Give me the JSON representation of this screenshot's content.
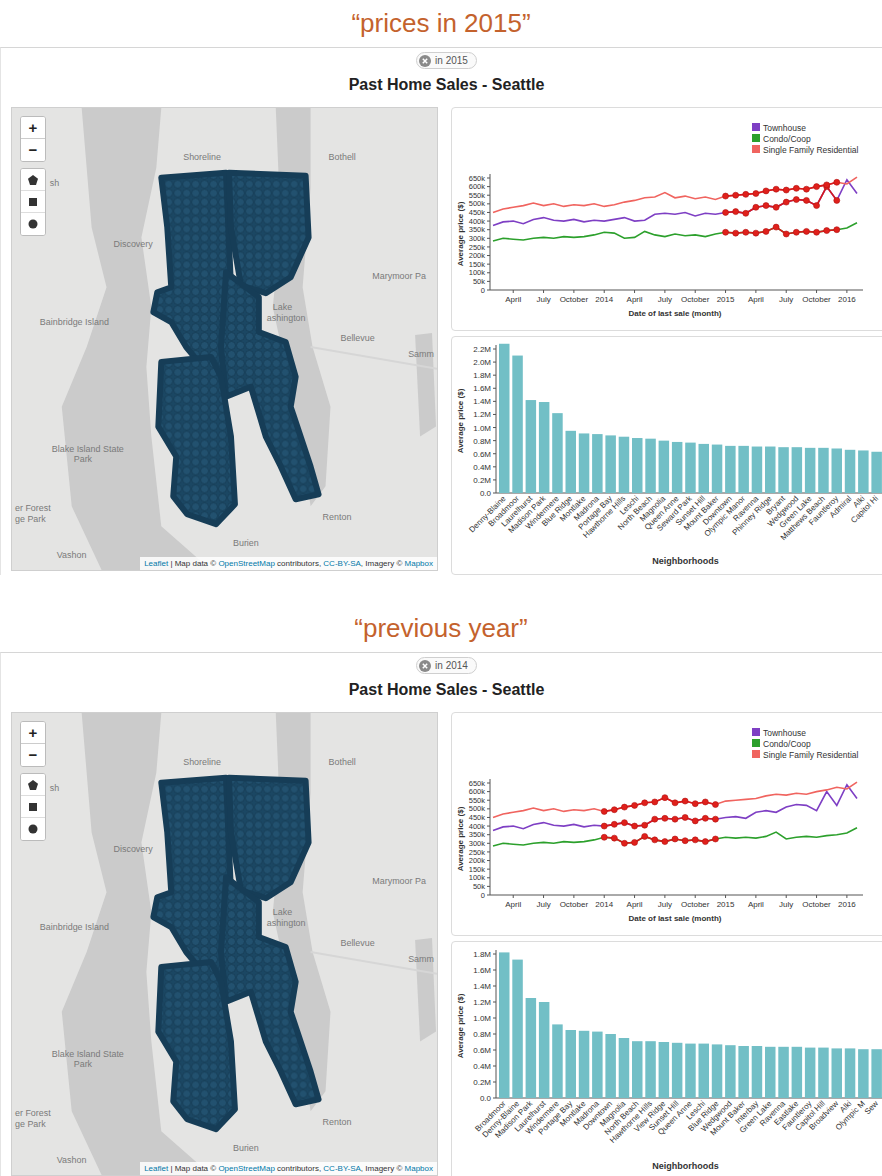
{
  "map": {
    "zoom_buttons": [
      "+",
      "−"
    ],
    "labels": [
      "Shoreline",
      "Bothell",
      "sh",
      "Discovery",
      "Marymoor Pa",
      "Bainbridge Island",
      "Lake",
      "ashington",
      "Bellevue",
      "Samm",
      "Blake Island State",
      "Park",
      "er Forest",
      "ge Park",
      "Renton",
      "Burien",
      "Vashon"
    ],
    "attribution": [
      {
        "text": "Leaflet",
        "link": true
      },
      {
        "text": " | Map data © ",
        "link": false
      },
      {
        "text": "OpenStreetMap",
        "link": true
      },
      {
        "text": " contributors, ",
        "link": false
      },
      {
        "text": "CC-BY-SA",
        "link": true
      },
      {
        "text": ", Imagery © ",
        "link": false
      },
      {
        "text": "Mapbox",
        "link": true
      }
    ]
  },
  "line_chart": {
    "y_label": "Average price ($)",
    "x_label": "Date of last sale (month)",
    "series": [
      {
        "name": "Townhouse",
        "color": "#7e3fc4",
        "values": [
          375000,
          395000,
          400000,
          385000,
          410000,
          420000,
          405000,
          400000,
          410000,
          395000,
          405000,
          400000,
          410000,
          420000,
          400000,
          405000,
          440000,
          445000,
          440000,
          450000,
          430000,
          445000,
          440000,
          450000,
          455000,
          445000,
          480000,
          490000,
          480000,
          510000,
          525000,
          520000,
          490000,
          600000,
          520000,
          640000,
          560000
        ]
      },
      {
        "name": "Condo/Coop",
        "color": "#2ca02c",
        "values": [
          285000,
          300000,
          295000,
          290000,
          300000,
          305000,
          300000,
          310000,
          305000,
          310000,
          320000,
          335000,
          330000,
          300000,
          305000,
          340000,
          320000,
          310000,
          325000,
          315000,
          320000,
          310000,
          325000,
          335000,
          330000,
          335000,
          330000,
          340000,
          365000,
          325000,
          335000,
          340000,
          335000,
          345000,
          350000,
          360000,
          390000
        ]
      },
      {
        "name": "Single Family Residential",
        "color": "#f0645f",
        "values": [
          450000,
          470000,
          480000,
          490000,
          505000,
          490000,
          500000,
          485000,
          495000,
          490000,
          500000,
          485000,
          495000,
          510000,
          520000,
          535000,
          540000,
          565000,
          535000,
          545000,
          530000,
          540000,
          525000,
          545000,
          550000,
          555000,
          560000,
          575000,
          585000,
          580000,
          590000,
          585000,
          600000,
          610000,
          625000,
          615000,
          655000
        ]
      }
    ],
    "y_ticks": [
      {
        "label": "650k",
        "value": 650000
      },
      {
        "label": "600k",
        "value": 600000
      },
      {
        "label": "550k",
        "value": 550000
      },
      {
        "label": "500k",
        "value": 500000
      },
      {
        "label": "450k",
        "value": 450000
      },
      {
        "label": "400k",
        "value": 400000
      },
      {
        "label": "350k",
        "value": 350000
      },
      {
        "label": "300k",
        "value": 300000
      },
      {
        "label": "250k",
        "value": 250000
      },
      {
        "label": "200k",
        "value": 200000
      },
      {
        "label": "150k",
        "value": 150000
      },
      {
        "label": "100k",
        "value": 100000
      },
      {
        "label": "50k",
        "value": 50000
      },
      {
        "label": "0",
        "value": 0
      }
    ],
    "x_ticks": [
      {
        "label": "April",
        "month": 2
      },
      {
        "label": "July",
        "month": 5
      },
      {
        "label": "October",
        "month": 8
      },
      {
        "label": "2014",
        "month": 11
      },
      {
        "label": "April",
        "month": 14
      },
      {
        "label": "July",
        "month": 17
      },
      {
        "label": "October",
        "month": 20
      },
      {
        "label": "2015",
        "month": 23
      },
      {
        "label": "April",
        "month": 26
      },
      {
        "label": "July",
        "month": 29
      },
      {
        "label": "October",
        "month": 32
      },
      {
        "label": "2016",
        "month": 35
      }
    ]
  },
  "panels": [
    {
      "caption": "“prices in 2015”",
      "filter_chip": "in 2015",
      "title": "Past Home Sales - Seattle",
      "highlight": {
        "from": 23,
        "to": 34
      },
      "bar_chart": {
        "y_label": "Average price ($)",
        "x_label": "Neighborhoods",
        "y_ticks": [
          {
            "label": "2.2M",
            "value": 2200000
          },
          {
            "label": "2.0M",
            "value": 2000000
          },
          {
            "label": "1.8M",
            "value": 1800000
          },
          {
            "label": "1.6M",
            "value": 1600000
          },
          {
            "label": "1.4M",
            "value": 1400000
          },
          {
            "label": "1.2M",
            "value": 1200000
          },
          {
            "label": "1.0M",
            "value": 1000000
          },
          {
            "label": "0.8M",
            "value": 800000
          },
          {
            "label": "0.6M",
            "value": 600000
          },
          {
            "label": "0.4M",
            "value": 400000
          },
          {
            "label": "0.2M",
            "value": 200000
          },
          {
            "label": "0.0",
            "value": 0
          }
        ],
        "bars": [
          {
            "label": "Denny-Blaine",
            "value": 2280000
          },
          {
            "label": "Broadmoor",
            "value": 2100000
          },
          {
            "label": "Laurelhurst",
            "value": 1420000
          },
          {
            "label": "Madison Park",
            "value": 1390000
          },
          {
            "label": "Windermere",
            "value": 1220000
          },
          {
            "label": "Blue Ridge",
            "value": 950000
          },
          {
            "label": "Montlake",
            "value": 910000
          },
          {
            "label": "Madrona",
            "value": 900000
          },
          {
            "label": "Portage Bay",
            "value": 880000
          },
          {
            "label": "Hawthorne Hills",
            "value": 860000
          },
          {
            "label": "Leschi",
            "value": 840000
          },
          {
            "label": "North Beach",
            "value": 830000
          },
          {
            "label": "Magnolia",
            "value": 800000
          },
          {
            "label": "Queen Anne",
            "value": 780000
          },
          {
            "label": "Seward Park",
            "value": 770000
          },
          {
            "label": "Sunset Hill",
            "value": 750000
          },
          {
            "label": "Mount Baker",
            "value": 740000
          },
          {
            "label": "Downtown",
            "value": 720000
          },
          {
            "label": "Olympic Manor",
            "value": 720000
          },
          {
            "label": "Ravenna",
            "value": 710000
          },
          {
            "label": "Phinney Ridge",
            "value": 710000
          },
          {
            "label": "Bryant",
            "value": 700000
          },
          {
            "label": "Wedgwood",
            "value": 700000
          },
          {
            "label": "Green Lake",
            "value": 690000
          },
          {
            "label": "Matthews Beach",
            "value": 690000
          },
          {
            "label": "Fauntleroy",
            "value": 680000
          },
          {
            "label": "Admiral",
            "value": 660000
          },
          {
            "label": "Alki",
            "value": 650000
          },
          {
            "label": "Capitol Hi",
            "value": 630000
          }
        ]
      }
    },
    {
      "caption": "“previous year”",
      "filter_chip": "in 2014",
      "title": "Past Home Sales - Seattle",
      "highlight": {
        "from": 11,
        "to": 22
      },
      "bar_chart": {
        "y_label": "Average price ($)",
        "x_label": "Neighborhoods",
        "y_ticks": [
          {
            "label": "1.8M",
            "value": 1800000
          },
          {
            "label": "1.6M",
            "value": 1600000
          },
          {
            "label": "1.4M",
            "value": 1400000
          },
          {
            "label": "1.2M",
            "value": 1200000
          },
          {
            "label": "1.0M",
            "value": 1000000
          },
          {
            "label": "0.8M",
            "value": 800000
          },
          {
            "label": "0.6M",
            "value": 600000
          },
          {
            "label": "0.4M",
            "value": 400000
          },
          {
            "label": "0.2M",
            "value": 200000
          },
          {
            "label": "0.0",
            "value": 0
          }
        ],
        "bars": [
          {
            "label": "Broadmoor",
            "value": 1820000
          },
          {
            "label": "Denny-Blaine",
            "value": 1730000
          },
          {
            "label": "Madison Park",
            "value": 1250000
          },
          {
            "label": "Laurelhurst",
            "value": 1200000
          },
          {
            "label": "Windermere",
            "value": 920000
          },
          {
            "label": "Portage Bay",
            "value": 850000
          },
          {
            "label": "Montlake",
            "value": 840000
          },
          {
            "label": "Madrona",
            "value": 830000
          },
          {
            "label": "Downtown",
            "value": 800000
          },
          {
            "label": "Magnolia",
            "value": 750000
          },
          {
            "label": "North Beach",
            "value": 710000
          },
          {
            "label": "Hawthorne Hills",
            "value": 710000
          },
          {
            "label": "View Ridge",
            "value": 700000
          },
          {
            "label": "Sunset Hill",
            "value": 690000
          },
          {
            "label": "Queen Anne",
            "value": 680000
          },
          {
            "label": "Leschi",
            "value": 680000
          },
          {
            "label": "Blue Ridge",
            "value": 670000
          },
          {
            "label": "Wedgwood",
            "value": 660000
          },
          {
            "label": "Mount Baker",
            "value": 650000
          },
          {
            "label": "Interbay",
            "value": 650000
          },
          {
            "label": "Green Lake",
            "value": 640000
          },
          {
            "label": "Ravenna",
            "value": 640000
          },
          {
            "label": "Eastlake",
            "value": 640000
          },
          {
            "label": "Fauntleroy",
            "value": 630000
          },
          {
            "label": "Capitol Hill",
            "value": 630000
          },
          {
            "label": "Broadview",
            "value": 620000
          },
          {
            "label": "Alki",
            "value": 620000
          },
          {
            "label": "Olympic M",
            "value": 610000
          },
          {
            "label": "Sew",
            "value": 610000
          }
        ]
      }
    }
  ]
}
